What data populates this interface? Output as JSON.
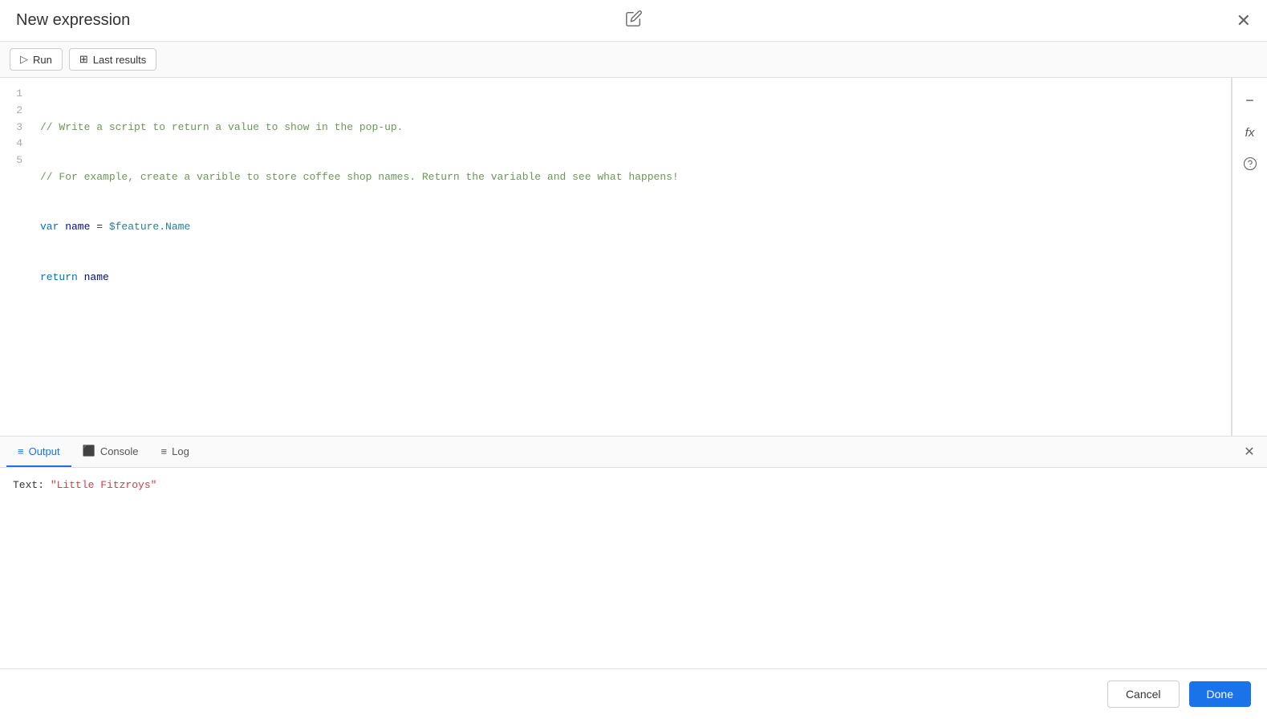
{
  "dialog": {
    "title": "New expression",
    "edit_icon": "✏",
    "close_icon": "✕"
  },
  "toolbar": {
    "run_label": "Run",
    "last_results_label": "Last results"
  },
  "code": {
    "lines": [
      {
        "number": "1",
        "content": "// Write a script to return a value to show in the pop-up.",
        "type": "comment"
      },
      {
        "number": "2",
        "content": "// For example, create a varible to store coffee shop names. Return the variable and see what happens!",
        "type": "comment"
      },
      {
        "number": "3",
        "content": "var name = $feature.Name",
        "type": "code"
      },
      {
        "number": "4",
        "content": "return name",
        "type": "code"
      },
      {
        "number": "5",
        "content": "",
        "type": "empty"
      }
    ]
  },
  "sidebar_tools": {
    "minus_label": "−",
    "fx_label": "fx",
    "help_label": "?"
  },
  "output_panel": {
    "tabs": [
      {
        "id": "output",
        "label": "Output",
        "icon": "≡",
        "active": true
      },
      {
        "id": "console",
        "label": "Console",
        "icon": "⬛",
        "active": false
      },
      {
        "id": "log",
        "label": "Log",
        "icon": "≡",
        "active": false
      }
    ],
    "output_content": {
      "label": "Text:",
      "value": "\"Little Fitzroys\""
    }
  },
  "footer": {
    "cancel_label": "Cancel",
    "done_label": "Done"
  }
}
